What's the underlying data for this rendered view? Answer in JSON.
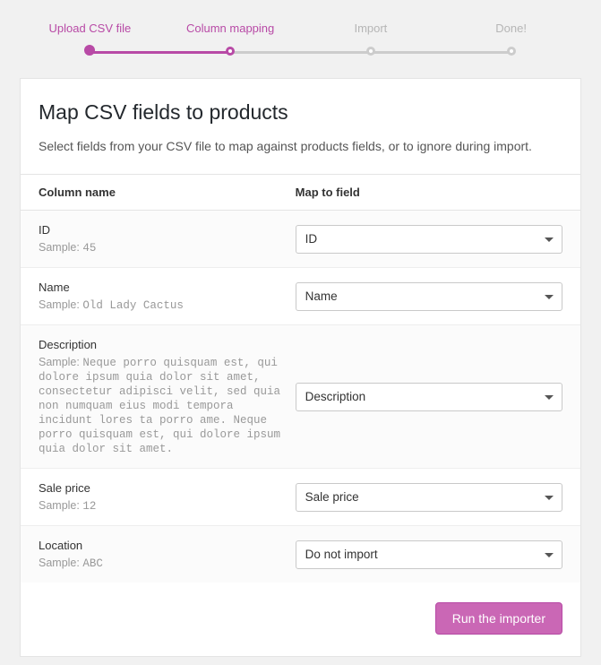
{
  "stepper": {
    "steps": [
      {
        "label": "Upload CSV file",
        "state": "done"
      },
      {
        "label": "Column mapping",
        "state": "active"
      },
      {
        "label": "Import",
        "state": "pending"
      },
      {
        "label": "Done!",
        "state": "pending"
      }
    ]
  },
  "header": {
    "title": "Map CSV fields to products",
    "description": "Select fields from your CSV file to map against products fields, or to ignore during import."
  },
  "table": {
    "col_name_header": "Column name",
    "col_map_header": "Map to field",
    "sample_prefix": "Sample:",
    "rows": [
      {
        "label": "ID",
        "sample": "45",
        "selected": "ID"
      },
      {
        "label": "Name",
        "sample": "Old Lady Cactus",
        "selected": "Name"
      },
      {
        "label": "Description",
        "sample": "Neque porro quisquam est, qui dolore ipsum quia dolor sit amet, consectetur adipisci velit, sed quia non numquam eius modi tempora incidunt lores ta porro ame. Neque porro quisquam est, qui dolore ipsum quia dolor sit amet.",
        "selected": "Description"
      },
      {
        "label": "Sale price",
        "sample": "12",
        "selected": "Sale price"
      },
      {
        "label": "Location",
        "sample": "ABC",
        "selected": "Do not import"
      }
    ],
    "options": [
      "Do not import",
      "ID",
      "Name",
      "Description",
      "Sale price"
    ]
  },
  "footer": {
    "submit_label": "Run the importer"
  },
  "colors": {
    "accent": "#b84aa6"
  }
}
